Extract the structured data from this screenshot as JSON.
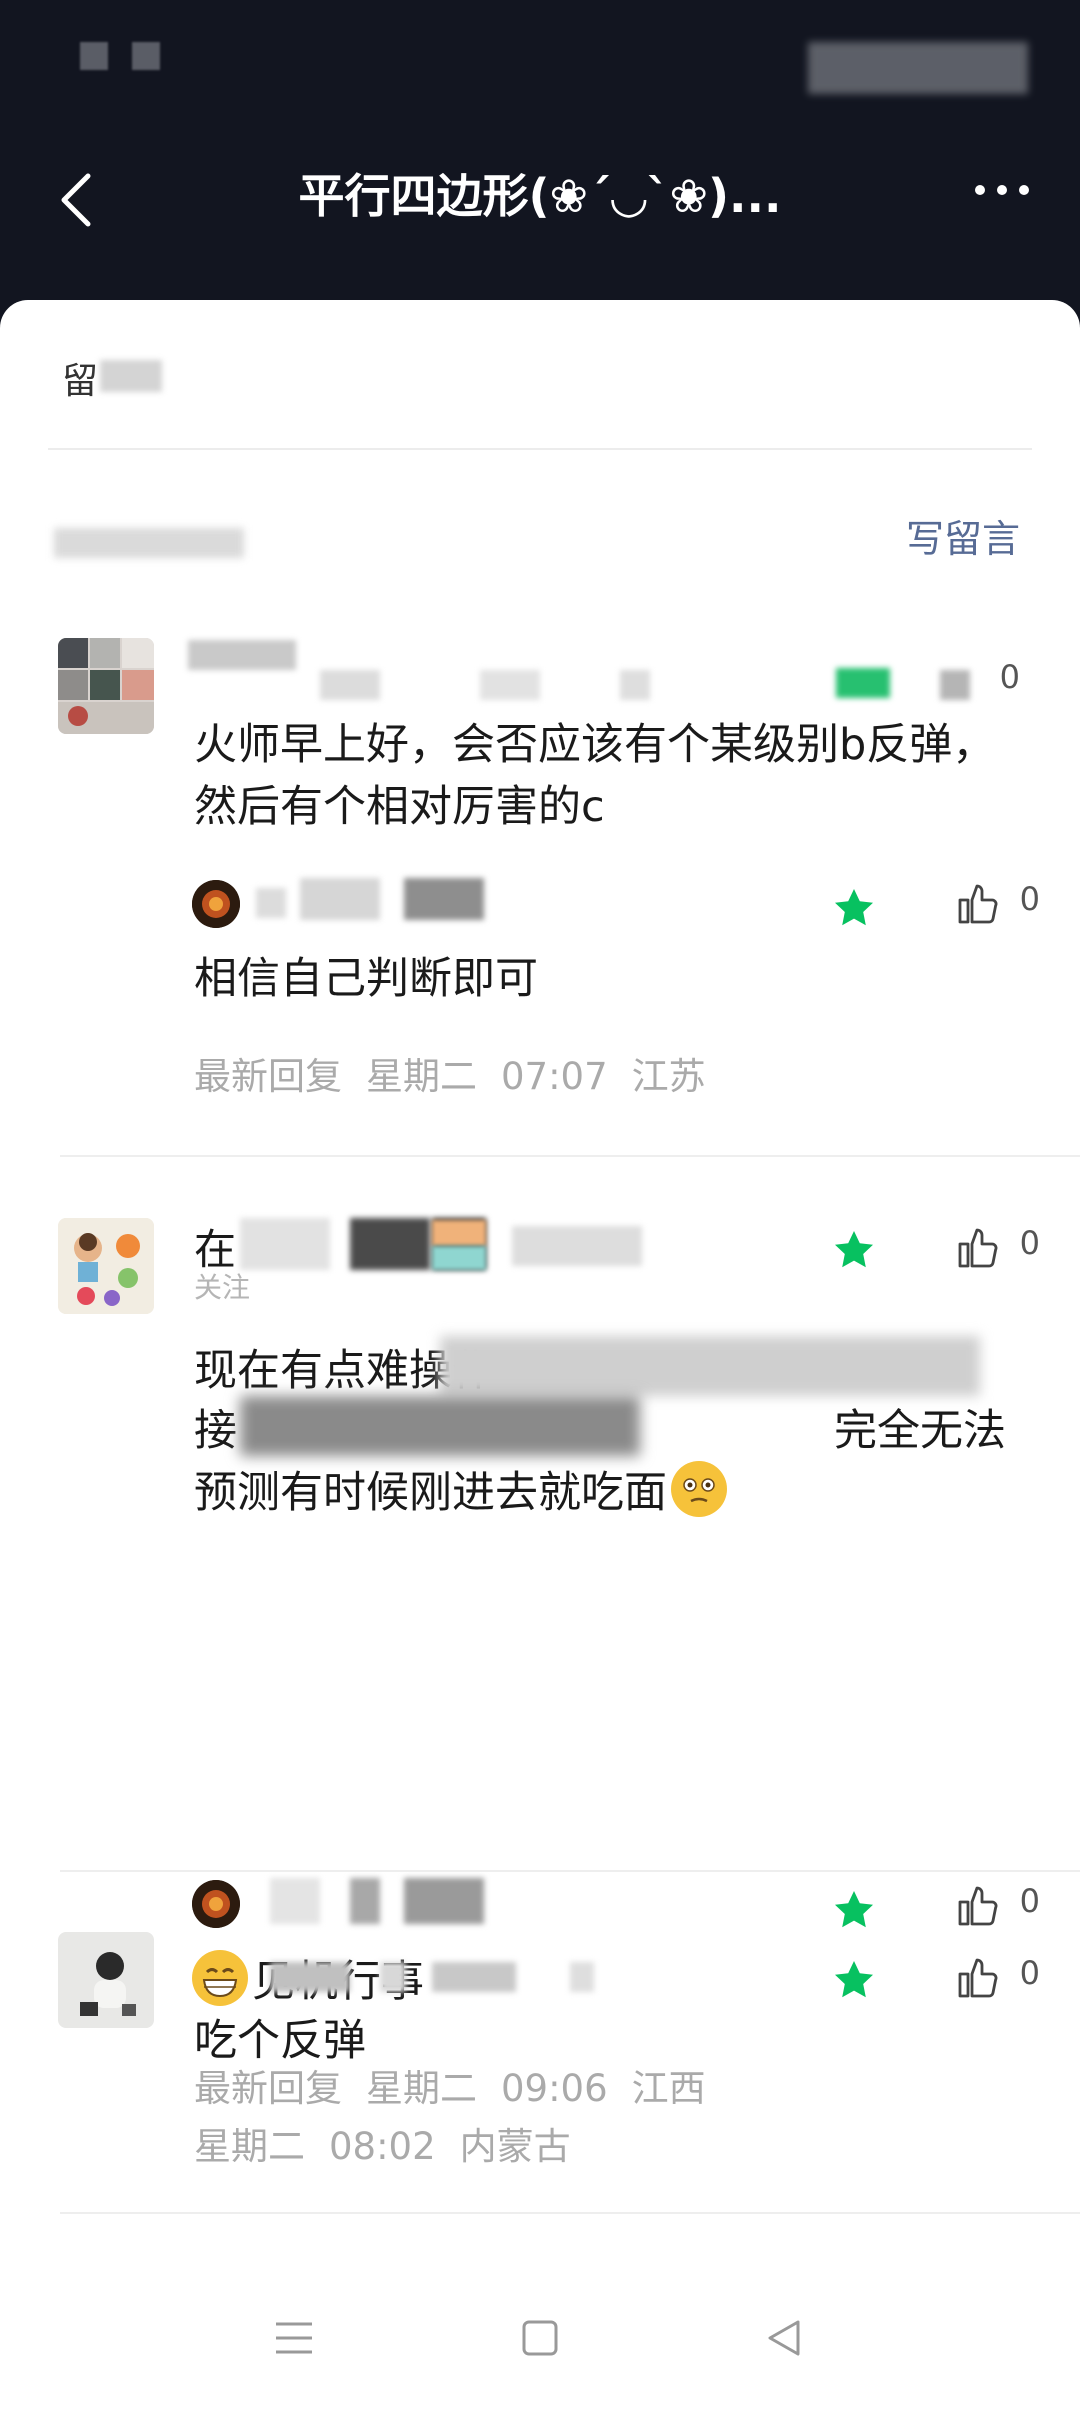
{
  "nav": {
    "title": "平行四边形(❀´◡`❀)..."
  },
  "sheet": {
    "header": "留",
    "write_label": "写留言"
  },
  "colors": {
    "accent_green": "#07c160",
    "link_blue": "#576b95",
    "meta_gray": "#aaaaaa"
  },
  "comments": [
    {
      "text": "火师早上好，会否应该有个某级别b反弹，然后有个相对厉害的c",
      "likes": "0",
      "reply": {
        "text": "相信自己判断即可",
        "likes": "0",
        "meta_label": "最新回复",
        "day": "星期二",
        "time": "07:07",
        "region": "江苏"
      }
    },
    {
      "name": "在",
      "sub": "关注",
      "text_line1": "现在有点难操作",
      "text_line2_start": "接",
      "text_line2_end": "完全无法",
      "text_line3": "预测有时候刚进去就吃面",
      "likes": "0",
      "reply": {
        "text": "见机行事",
        "likes": "0",
        "meta_label": "最新回复",
        "day": "星期二",
        "time": "09:06",
        "region": "江西"
      }
    },
    {
      "text": "吃个反弹",
      "likes": "0",
      "day": "星期二",
      "time": "08:02",
      "region": "内蒙古"
    }
  ],
  "icons": {
    "back": "chevron-left-icon",
    "more": "more-dots-icon",
    "star": "star-icon",
    "like": "thumbs-up-icon",
    "menu": "menu-lines-icon",
    "home": "square-home-icon",
    "back_nav": "triangle-back-icon"
  }
}
